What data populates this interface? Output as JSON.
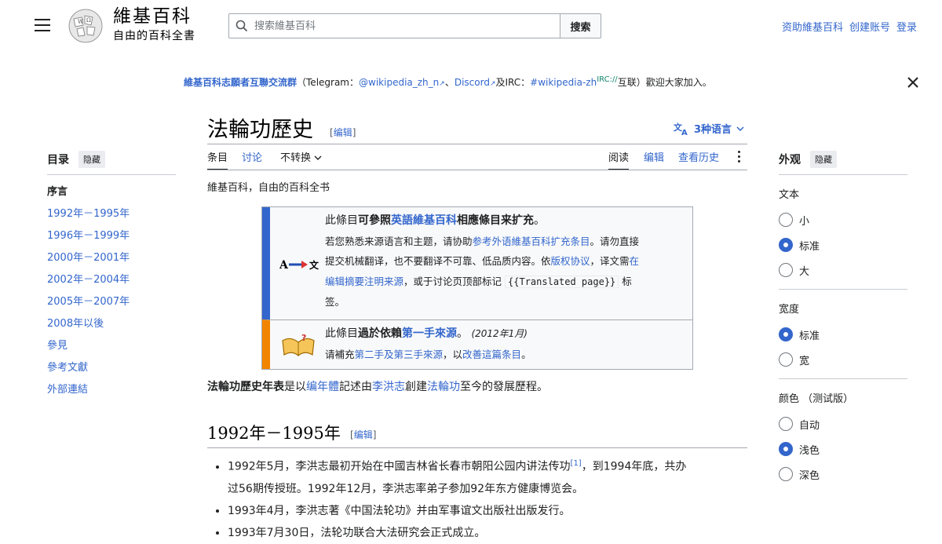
{
  "header": {
    "site_title": "維基百科",
    "site_tagline": "自由的百科全書",
    "search_placeholder": "搜索維基百科",
    "search_button": "搜索",
    "user_links": [
      "资助維基百科",
      "创建账号",
      "登录"
    ]
  },
  "sitenotice": {
    "group": "維基百科志願者互聯交流群",
    "open": "（Telegram：",
    "tg": "@wikipedia_zh_n",
    "sep": "、",
    "discord": "Discord",
    "and": "及IRC：",
    "irc": "#wikipedia-zh",
    "irc_sup": "IRC://",
    "tail": "互联）歡迎大家加入。"
  },
  "toc": {
    "title": "目录",
    "hide": "隐藏",
    "items": [
      "序言",
      "1992年－1995年",
      "1996年－1999年",
      "2000年－2001年",
      "2002年－2004年",
      "2005年－2007年",
      "2008年以後",
      "參見",
      "參考文獻",
      "外部連結"
    ]
  },
  "article": {
    "title": "法輪功歷史",
    "edit": "编辑",
    "languages": "3种语言",
    "tabs_left": [
      "条目",
      "讨论",
      "不转换"
    ],
    "tabs_right": [
      "阅读",
      "编辑",
      "查看历史"
    ],
    "from": "維基百科，自由的百科全书",
    "ambox1": {
      "l1a": "此條目",
      "l1b": "可參照",
      "l1c": "英語維基百科",
      "l1d": "相應條目来扩充",
      "l1e": "。",
      "l2a": "若您熟悉来源语言和主题，请协助",
      "l2b": "参考外语維基百科扩充条目",
      "l2c": "。请勿直接",
      "l3a": "提交机械翻译，也不要翻译不可靠、低品质内容。依",
      "l3b": "版权协议",
      "l3c": "，译文需",
      "l3d": "在",
      "l4a": "编辑摘要注明来源",
      "l4b": "，或于讨论页顶部标记",
      "l4code": "{{Translated page}}",
      "l4c": "标",
      "l5": "签。"
    },
    "ambox2": {
      "l1a": "此條目",
      "l1b": "過於依賴",
      "l1c": "第一手來源",
      "l1d": "。",
      "date": "(2012年1月)",
      "l2a": "请補充",
      "l2b": "第二手及第三手來源",
      "l2c": "，以",
      "l2d": "改善這篇条目",
      "l2e": "。"
    },
    "lead": {
      "a": "法輪功歷史年表",
      "b": "是以",
      "c": "编年體",
      "d": "記述由",
      "e": "李洪志",
      "f": "創建",
      "g": "法輪功",
      "h": "至今的發展歷程。"
    },
    "section_title": "1992年－1995年",
    "events": {
      "e1a": "1992年5月，李洪志最初开始在中國吉林省长春市朝阳公园内讲法传功",
      "e1ref": "[1]",
      "e1b": "，到1994年底，共办",
      "e1c": "过56期传授班。1992年12月，李洪志率弟子参加92年东方健康博览会。",
      "e2": "1993年4月，李洪志著《中国法轮功》并由军事谊文出版社出版发行。",
      "e3": "1993年7月30日，法轮功联合大法研究会正式成立。"
    }
  },
  "appearance": {
    "title": "外观",
    "hide": "隐藏",
    "text_label": "文本",
    "text_options": [
      "小",
      "标准",
      "大"
    ],
    "text_selected": "标准",
    "width_label": "宽度",
    "width_options": [
      "标准",
      "宽"
    ],
    "width_selected": "标准",
    "color_label": "颜色 （测试版）",
    "color_options": [
      "自动",
      "浅色",
      "深色"
    ],
    "color_selected": "浅色"
  },
  "colors": {
    "link": "#3366cc",
    "notice_blue": "#36c",
    "notice_orange": "#f28500"
  }
}
